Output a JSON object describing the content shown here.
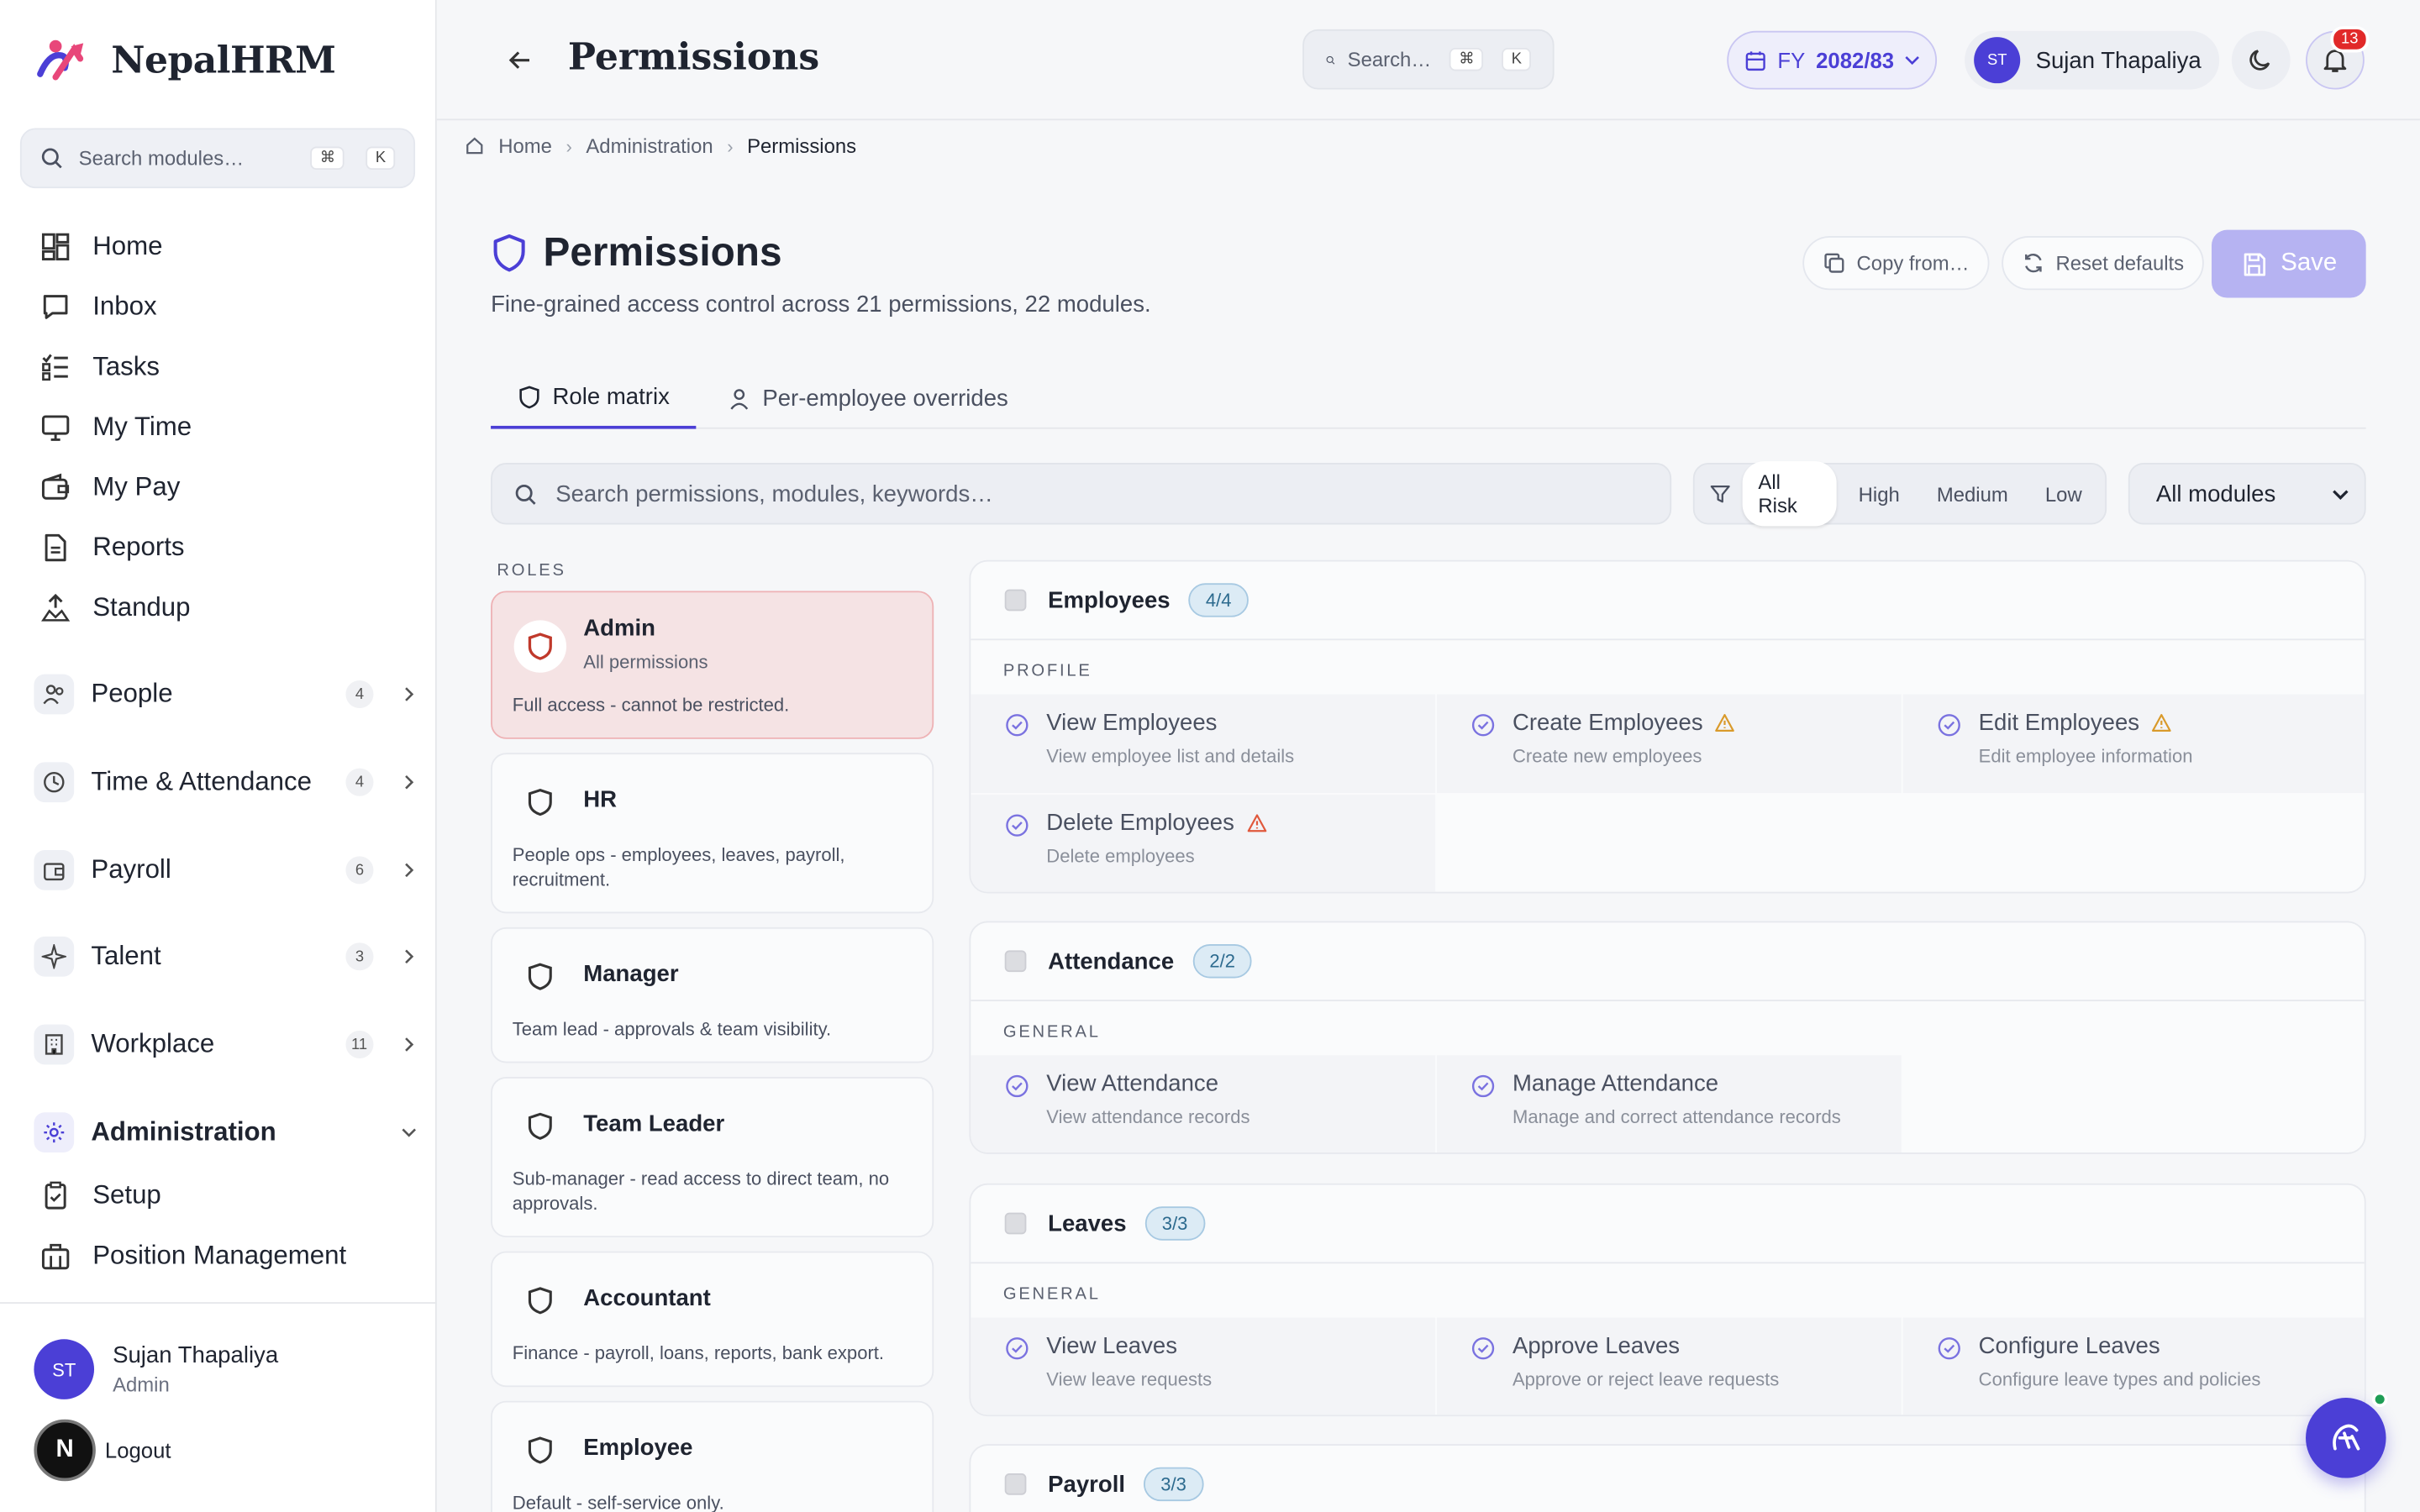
{
  "brand": {
    "name": "NepalHRM"
  },
  "sidebar": {
    "search_placeholder": "Search modules…",
    "kbd1": "⌘",
    "kbd2": "K",
    "items": [
      {
        "label": "Home",
        "icon": "grid-icon"
      },
      {
        "label": "Inbox",
        "icon": "message-icon"
      },
      {
        "label": "Tasks",
        "icon": "tasks-icon"
      },
      {
        "label": "My Time",
        "icon": "monitor-icon"
      },
      {
        "label": "My Pay",
        "icon": "wallet-icon"
      },
      {
        "label": "Reports",
        "icon": "report-icon"
      },
      {
        "label": "Standup",
        "icon": "standup-icon"
      }
    ],
    "groups": [
      {
        "label": "People",
        "count": "4"
      },
      {
        "label": "Time & Attendance",
        "count": "4"
      },
      {
        "label": "Payroll",
        "count": "6"
      },
      {
        "label": "Talent",
        "count": "3"
      },
      {
        "label": "Workplace",
        "count": "11"
      }
    ],
    "admin": {
      "label": "Administration",
      "items": [
        "Setup",
        "Position Management"
      ]
    },
    "user": {
      "initials": "ST",
      "name": "Sujan Thapaliya",
      "role": "Admin"
    },
    "logout": "Logout",
    "n_badge": "N"
  },
  "topbar": {
    "title": "Permissions",
    "search_placeholder": "Search…",
    "kbd1": "⌘",
    "kbd2": "K",
    "fy_prefix": "FY",
    "fy_value": "2082/83",
    "user_initials": "ST",
    "user_name": "Sujan Thapaliya",
    "notifications": "13"
  },
  "breadcrumb": {
    "home": "Home",
    "section": "Administration",
    "current": "Permissions"
  },
  "page": {
    "title": "Permissions",
    "subtitle": "Fine-grained access control across 21 permissions, 22 modules.",
    "copy_label": "Copy from…",
    "reset_label": "Reset defaults",
    "save_label": "Save"
  },
  "tabs": [
    {
      "label": "Role matrix",
      "active": true
    },
    {
      "label": "Per-employee overrides",
      "active": false
    }
  ],
  "filters": {
    "search_placeholder": "Search permissions, modules, keywords…",
    "risk": [
      "All Risk",
      "High",
      "Medium",
      "Low"
    ],
    "module_select": "All modules"
  },
  "roles": {
    "label": "ROLES",
    "items": [
      {
        "name": "Admin",
        "sub": "All permissions",
        "desc": "Full access - cannot be restricted."
      },
      {
        "name": "HR",
        "desc": "People ops - employees, leaves, payroll, recruitment."
      },
      {
        "name": "Manager",
        "desc": "Team lead - approvals & team visibility."
      },
      {
        "name": "Team Leader",
        "desc": "Sub-manager - read access to direct team, no approvals."
      },
      {
        "name": "Accountant",
        "desc": "Finance - payroll, loans, reports, bank export."
      },
      {
        "name": "Employee",
        "desc": "Default - self-service only."
      }
    ]
  },
  "modules": [
    {
      "name": "Employees",
      "badge": "4/4",
      "section": "PROFILE",
      "perms": [
        {
          "title": "View Employees",
          "desc": "View employee list and details",
          "warn": false
        },
        {
          "title": "Create Employees",
          "desc": "Create new employees",
          "warn": true
        },
        {
          "title": "Edit Employees",
          "desc": "Edit employee information",
          "warn": true
        },
        {
          "title": "Delete Employees",
          "desc": "Delete employees",
          "warn": true
        }
      ]
    },
    {
      "name": "Attendance",
      "badge": "2/2",
      "section": "GENERAL",
      "perms": [
        {
          "title": "View Attendance",
          "desc": "View attendance records",
          "warn": false
        },
        {
          "title": "Manage Attendance",
          "desc": "Manage and correct attendance records",
          "warn": false
        }
      ]
    },
    {
      "name": "Leaves",
      "badge": "3/3",
      "section": "GENERAL",
      "perms": [
        {
          "title": "View Leaves",
          "desc": "View leave requests",
          "warn": false
        },
        {
          "title": "Approve Leaves",
          "desc": "Approve or reject leave requests",
          "warn": false
        },
        {
          "title": "Configure Leaves",
          "desc": "Configure leave types and policies",
          "warn": false
        }
      ]
    },
    {
      "name": "Payroll",
      "badge": "3/3"
    }
  ],
  "colors": {
    "accent": "#4b3fd6",
    "admin_bg": "#f5e3e4",
    "warn": "#d99a2b"
  }
}
